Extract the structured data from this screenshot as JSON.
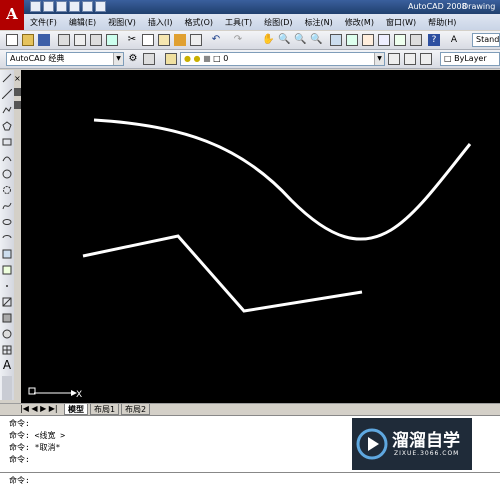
{
  "window": {
    "app_title": "AutoCAD 2008",
    "doc_title": "Drawing"
  },
  "menu": [
    "文件(F)",
    "编辑(E)",
    "视图(V)",
    "插入(I)",
    "格式(O)",
    "工具(T)",
    "绘图(D)",
    "标注(N)",
    "修改(M)",
    "窗口(W)",
    "帮助(H)"
  ],
  "toolbar2": {
    "workspace": "AutoCAD 经典",
    "layer": "0",
    "linetype": "ByLayer",
    "textstyle": "Stand"
  },
  "drawing": {
    "ucs_x_label": "X",
    "ucs_y_label": "Y"
  },
  "tabs": [
    "模型",
    "布局1",
    "布局2"
  ],
  "command": {
    "lines": [
      "命令:",
      "命令: <线宽 >",
      "命令: *取消*",
      "命令:"
    ],
    "prompt": "命令:"
  },
  "watermark": {
    "brand": "溜溜自学",
    "url": "ZIXUE.3066.COM"
  },
  "icons": [
    "new-icon",
    "open-icon",
    "save-icon",
    "print-icon",
    "undo-icon",
    "redo-icon",
    "line-icon",
    "polyline-icon",
    "circle-icon",
    "arc-icon",
    "rectangle-icon",
    "hatch-icon",
    "text-icon"
  ],
  "colors": {
    "canvas": "#000000",
    "line": "#ffffff",
    "title": "#20406e",
    "logo": "#b10000"
  }
}
